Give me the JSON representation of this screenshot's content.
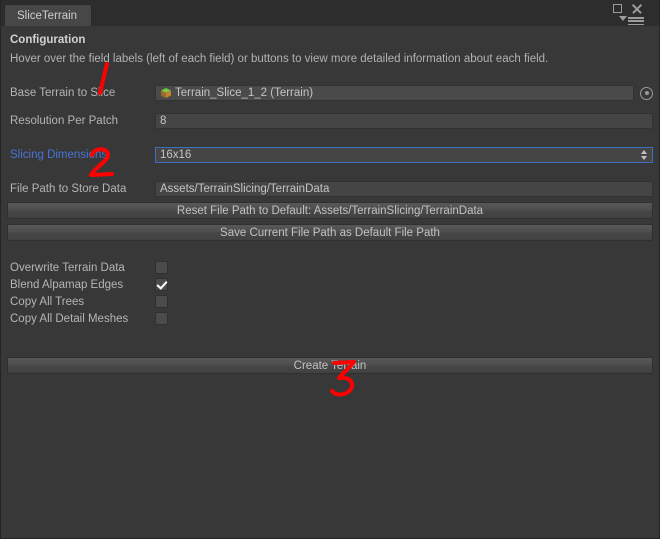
{
  "window": {
    "tab_label": "SliceTerrain",
    "maximize_icon": "maximize-square-icon",
    "close_icon": "close-x-icon",
    "menu_icon": "hamburger-menu-icon",
    "filter_icon": "filter-triangle-icon"
  },
  "content": {
    "heading": "Configuration",
    "description": "Hover over the field labels (left of each field) or buttons to view more detailed information about each field."
  },
  "fields": {
    "base_terrain": {
      "label": "Base Terrain to Slice",
      "value": "Terrain_Slice_1_2 (Terrain)",
      "icon": "terrain-cube-icon",
      "picker_icon": "object-picker-icon"
    },
    "resolution": {
      "label": "Resolution Per Patch",
      "value": "8"
    },
    "slicing_dimensions": {
      "label": "Slicing Dimensions",
      "value": "16x16",
      "arrows_icon": "popup-arrows-icon"
    },
    "file_path": {
      "label": "File Path to Store Data",
      "value": "Assets/TerrainSlicing/TerrainData"
    }
  },
  "buttons": {
    "reset_path": "Reset File Path to Default: Assets/TerrainSlicing/TerrainData",
    "save_path": "Save Current File Path as Default File Path",
    "create_terrain": "Create Terrain"
  },
  "toggles": [
    {
      "label": "Overwrite Terrain Data",
      "checked": false
    },
    {
      "label": "Blend Alpamap Edges",
      "checked": true
    },
    {
      "label": "Copy All Trees",
      "checked": false
    },
    {
      "label": "Copy All Detail Meshes",
      "checked": false
    }
  ],
  "annotations": [
    {
      "label": "1",
      "name": "annotation-1"
    },
    {
      "label": "2",
      "name": "annotation-2"
    },
    {
      "label": "3",
      "name": "annotation-3"
    }
  ],
  "colors": {
    "background": "#383838",
    "tab_active": "#474747",
    "link": "#4874d6",
    "focus_border": "#3d6fc4",
    "annotation": "#fe0000"
  }
}
